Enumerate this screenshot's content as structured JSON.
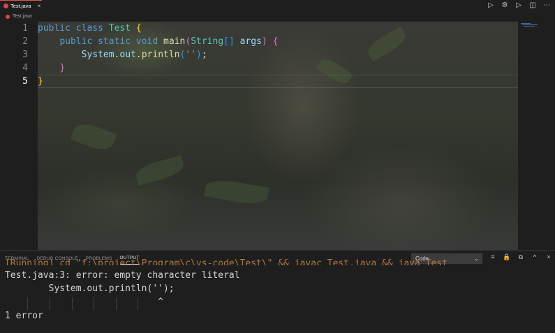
{
  "tab": {
    "label": "Test.java",
    "close": "×"
  },
  "actions": [
    "▷",
    "⚙",
    "▷",
    "◫",
    "⋯"
  ],
  "breadcrumb": {
    "file": "Test.java"
  },
  "editor": {
    "line_numbers": [
      "1",
      "2",
      "3",
      "4",
      "5"
    ],
    "lines": [
      {
        "parts": [
          [
            "kw",
            "public"
          ],
          [
            "pl",
            " "
          ],
          [
            "kw",
            "class"
          ],
          [
            "pl",
            " "
          ],
          [
            "ty",
            "Test"
          ],
          [
            "pl",
            " "
          ],
          [
            "br1",
            "{"
          ]
        ]
      },
      {
        "parts": [
          [
            "pl",
            "    "
          ],
          [
            "kw",
            "public"
          ],
          [
            "pl",
            " "
          ],
          [
            "kw",
            "static"
          ],
          [
            "pl",
            " "
          ],
          [
            "kw",
            "void"
          ],
          [
            "pl",
            " "
          ],
          [
            "fn",
            "main"
          ],
          [
            "br2",
            "("
          ],
          [
            "ty",
            "String"
          ],
          [
            "br3",
            "[]"
          ],
          [
            "pl",
            " "
          ],
          [
            "vr",
            "args"
          ],
          [
            "br2",
            ")"
          ],
          [
            "pl",
            " "
          ],
          [
            "br2",
            "{"
          ]
        ]
      },
      {
        "parts": [
          [
            "pl",
            "        "
          ],
          [
            "vr",
            "System"
          ],
          [
            "pl",
            "."
          ],
          [
            "vr",
            "out"
          ],
          [
            "pl",
            "."
          ],
          [
            "fn",
            "println"
          ],
          [
            "br3",
            "("
          ],
          [
            "str",
            "''"
          ],
          [
            "br3",
            ")"
          ],
          [
            "pl",
            ";"
          ]
        ]
      },
      {
        "parts": [
          [
            "pl",
            "    "
          ],
          [
            "br2",
            "}"
          ]
        ]
      },
      {
        "parts": [
          [
            "br1",
            "}"
          ]
        ]
      }
    ]
  },
  "panel": {
    "tabs": [
      "TERMINAL",
      "DEBUG CONSOLE",
      "PROBLEMS",
      "OUTPUT"
    ],
    "active_tab": "OUTPUT",
    "select_value": "Code",
    "icons": [
      "≡",
      "🔒",
      "⧉",
      "^",
      "×"
    ],
    "output": {
      "faded": "[Running] cd \"f:\\project\\Program\\c\\vs-code\\Test\\\" && javac Test.java && java Test",
      "line1": "Test.java:3: error: empty character literal",
      "line2": "        System.out.println('');",
      "line3": "                            ^",
      "line4": "1 error"
    }
  },
  "colors": {
    "accent": "#e0443e",
    "keyword": "#569cd6",
    "type": "#4ec9b0",
    "function": "#dcdcaa"
  }
}
